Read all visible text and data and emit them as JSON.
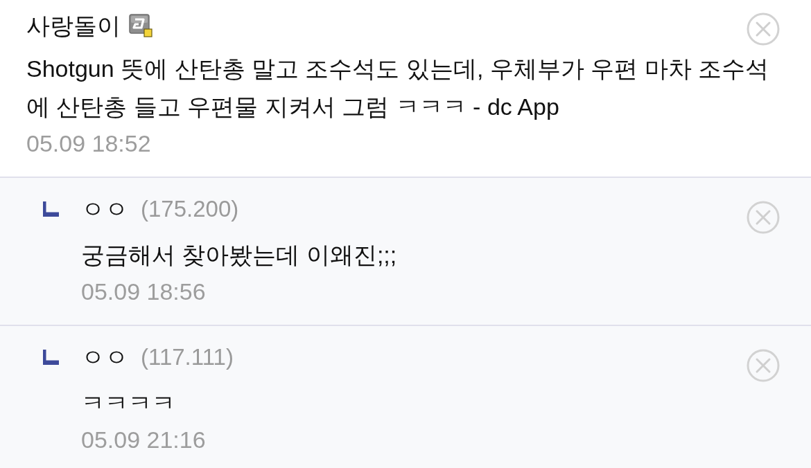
{
  "comments": [
    {
      "kind": "comment",
      "nickname": "사랑돌이",
      "fixed_nick": true,
      "text": "Shotgun 뜻에 산탄총 말고 조수석도 있는데, 우체부가 우편 마차 조수석에 산탄총 들고 우편물 지켜서 그럼 ㅋㅋㅋ - dc App",
      "date": "05.09 18:52"
    },
    {
      "kind": "reply",
      "nickname": "ㅇㅇ",
      "ip": "(175.200)",
      "fixed_nick": false,
      "text": "궁금해서 찾아봤는데 이왜진;;;",
      "date": "05.09 18:56"
    },
    {
      "kind": "reply",
      "nickname": "ㅇㅇ",
      "ip": "(117.111)",
      "fixed_nick": false,
      "text": "ㅋㅋㅋㅋ",
      "date": "05.09 21:16"
    }
  ]
}
